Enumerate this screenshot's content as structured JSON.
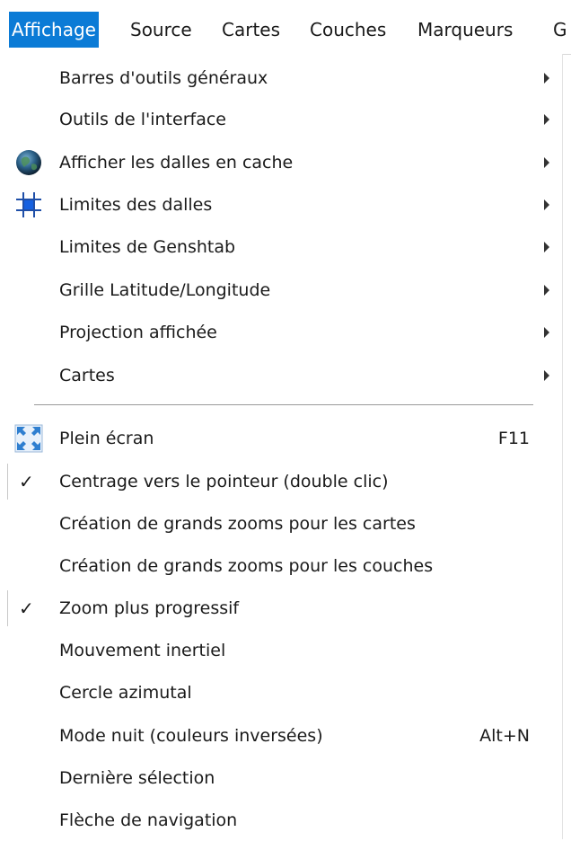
{
  "menubar": {
    "items": [
      {
        "label": "Affichage",
        "active": true
      },
      {
        "label": "Source"
      },
      {
        "label": "Cartes"
      },
      {
        "label": "Couches"
      },
      {
        "label": "Marqueurs"
      },
      {
        "label": "G"
      }
    ]
  },
  "menu": {
    "items": [
      {
        "label": "Barres d'outils généraux",
        "submenu": true
      },
      {
        "label": "Outils de l'interface",
        "submenu": true
      },
      {
        "label": "Afficher les dalles en cache",
        "submenu": true,
        "icon": "globe-icon"
      },
      {
        "label": "Limites des dalles",
        "submenu": true,
        "icon": "tile-bounds-icon"
      },
      {
        "label": "Limites de Genshtab",
        "submenu": true
      },
      {
        "label": "Grille Latitude/Longitude",
        "submenu": true
      },
      {
        "label": "Projection affichée",
        "submenu": true
      },
      {
        "label": "Cartes",
        "submenu": true
      },
      {
        "label": "Plein écran",
        "shortcut": "F11",
        "icon": "fullscreen-icon"
      },
      {
        "label": "Centrage vers le pointeur (double clic)",
        "checked": true
      },
      {
        "label": "Création de grands zooms pour les cartes"
      },
      {
        "label": "Création de grands zooms pour les couches"
      },
      {
        "label": "Zoom plus progressif",
        "checked": true
      },
      {
        "label": "Mouvement inertiel"
      },
      {
        "label": "Cercle azimutal"
      },
      {
        "label": "Mode nuit (couleurs inversées)",
        "shortcut": "Alt+N"
      },
      {
        "label": "Dernière sélection"
      },
      {
        "label": "Flèche de navigation"
      }
    ]
  },
  "check_glyph": "✓",
  "colors": {
    "accent": "#0b7bd6",
    "text": "#1a1a1a",
    "separator": "#9a9a9a"
  }
}
